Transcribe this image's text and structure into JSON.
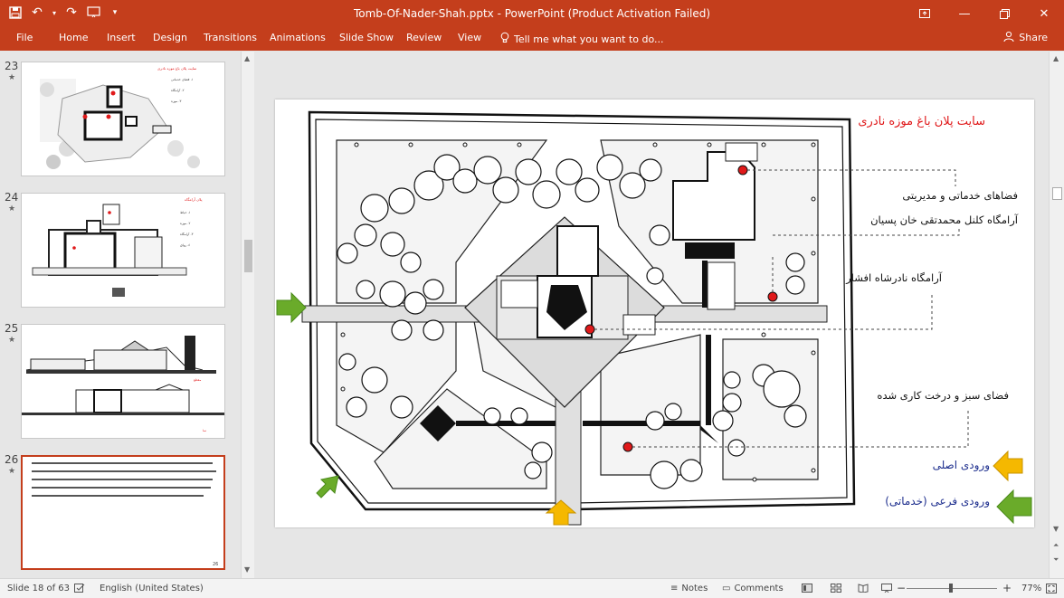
{
  "window": {
    "title": "Tomb-Of-Nader-Shah.pptx - PowerPoint (Product Activation Failed)"
  },
  "ribbon": {
    "tabs": [
      "File",
      "Home",
      "Insert",
      "Design",
      "Transitions",
      "Animations",
      "Slide Show",
      "Review",
      "View"
    ],
    "tell_me": "Tell me what you want to do...",
    "share": "Share"
  },
  "thumbnails": [
    {
      "number": "23",
      "star": "★"
    },
    {
      "number": "24",
      "star": "★"
    },
    {
      "number": "25",
      "star": "★"
    },
    {
      "number": "26",
      "star": "★"
    }
  ],
  "slide": {
    "title": "سایت پلان باغ موزه نادری",
    "labels": {
      "services": "فضاهای خدماتی و مدیریتی",
      "colonel_tomb": "آرامگاه کلنل محمدتقی خان پسیان",
      "nader_tomb": "آرامگاه نادرشاه افشار",
      "green_space": "فضای سبز و درخت کاری شده"
    },
    "legend": {
      "main_entrance": "ورودی اصلی",
      "service_entrance": "ورودی فرعی (خدماتی)"
    }
  },
  "status": {
    "slide_info": "Slide 18 of 63",
    "language": "English (United States)",
    "notes": "Notes",
    "comments": "Comments",
    "zoom": "77%"
  },
  "colors": {
    "accent": "#c43e1c",
    "marker_red": "#e0191a",
    "legend_blue": "#1e2f8e",
    "arrow_yellow": "#f5b800",
    "arrow_green": "#6aab2a"
  }
}
